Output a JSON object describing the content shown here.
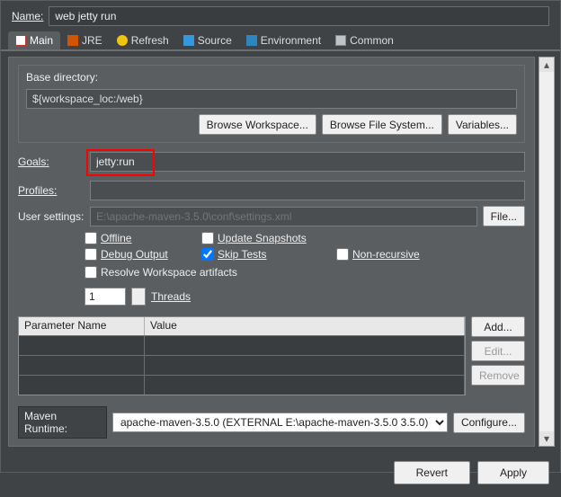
{
  "name": {
    "label": "Name:",
    "value": "web jetty run"
  },
  "tabs": {
    "main": "Main",
    "jre": "JRE",
    "refresh": "Refresh",
    "source": "Source",
    "environment": "Environment",
    "common": "Common"
  },
  "base": {
    "label": "Base directory:",
    "value": "${workspace_loc:/web}",
    "browse_workspace": "Browse Workspace...",
    "browse_filesystem": "Browse File System...",
    "variables": "Variables..."
  },
  "goals": {
    "label": "Goals:",
    "value": "jetty:run"
  },
  "profiles": {
    "label": "Profiles:",
    "value": ""
  },
  "user_settings": {
    "label": "User settings:",
    "placeholder": "E:\\apache-maven-3.5.0\\conf\\settings.xml",
    "file_btn": "File..."
  },
  "checks": {
    "offline": "Offline",
    "update_snapshots": "Update Snapshots",
    "debug_output": "Debug Output",
    "skip_tests": "Skip Tests",
    "non_recursive": "Non-recursive",
    "resolve": "Resolve Workspace artifacts"
  },
  "threads": {
    "value": "1",
    "label": "Threads"
  },
  "table": {
    "col_name": "Parameter Name",
    "col_value": "Value",
    "add": "Add...",
    "edit": "Edit...",
    "remove": "Remove"
  },
  "runtime": {
    "label": "Maven Runtime:",
    "value": "apache-maven-3.5.0 (EXTERNAL E:\\apache-maven-3.5.0 3.5.0)",
    "configure": "Configure..."
  },
  "footer": {
    "revert": "Revert",
    "apply": "Apply"
  }
}
